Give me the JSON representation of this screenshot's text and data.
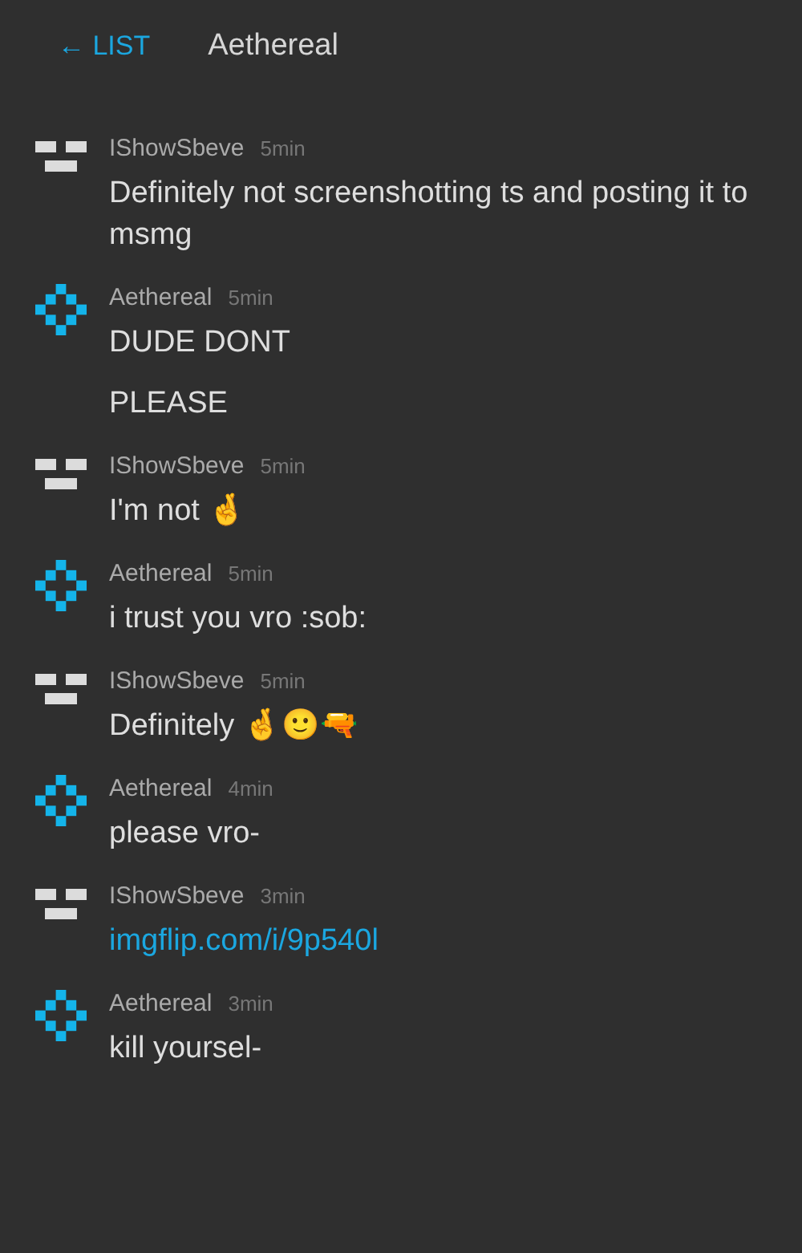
{
  "header": {
    "back_link": "← LIST",
    "title": "Aethereal"
  },
  "messages": [
    {
      "kind": "bars",
      "author": "IShowSbeve",
      "time": "5min",
      "lines": [
        {
          "kind": "text",
          "text": "Definitely not screenshotting ts and posting it to msmg"
        }
      ]
    },
    {
      "kind": "diamond",
      "author": "Aethereal",
      "time": "5min",
      "lines": [
        {
          "kind": "text",
          "text": "DUDE DONT"
        },
        {
          "kind": "text",
          "text": "PLEASE"
        }
      ]
    },
    {
      "kind": "bars",
      "author": "IShowSbeve",
      "time": "5min",
      "lines": [
        {
          "kind": "text",
          "text": "I'm not 🤞"
        }
      ]
    },
    {
      "kind": "diamond",
      "author": "Aethereal",
      "time": "5min",
      "lines": [
        {
          "kind": "text",
          "text": "i trust you vro :sob:"
        }
      ]
    },
    {
      "kind": "bars",
      "author": "IShowSbeve",
      "time": "5min",
      "lines": [
        {
          "kind": "text",
          "text": "Definitely 🤞🙂🔫"
        }
      ]
    },
    {
      "kind": "diamond",
      "author": "Aethereal",
      "time": "4min",
      "lines": [
        {
          "kind": "text",
          "text": "please vro-"
        }
      ]
    },
    {
      "kind": "bars",
      "author": "IShowSbeve",
      "time": "3min",
      "lines": [
        {
          "kind": "link",
          "text": "imgflip.com/i/9p540l"
        }
      ]
    },
    {
      "kind": "diamond",
      "author": "Aethereal",
      "time": "3min",
      "lines": [
        {
          "kind": "text",
          "text": "kill yoursel-"
        }
      ]
    }
  ]
}
